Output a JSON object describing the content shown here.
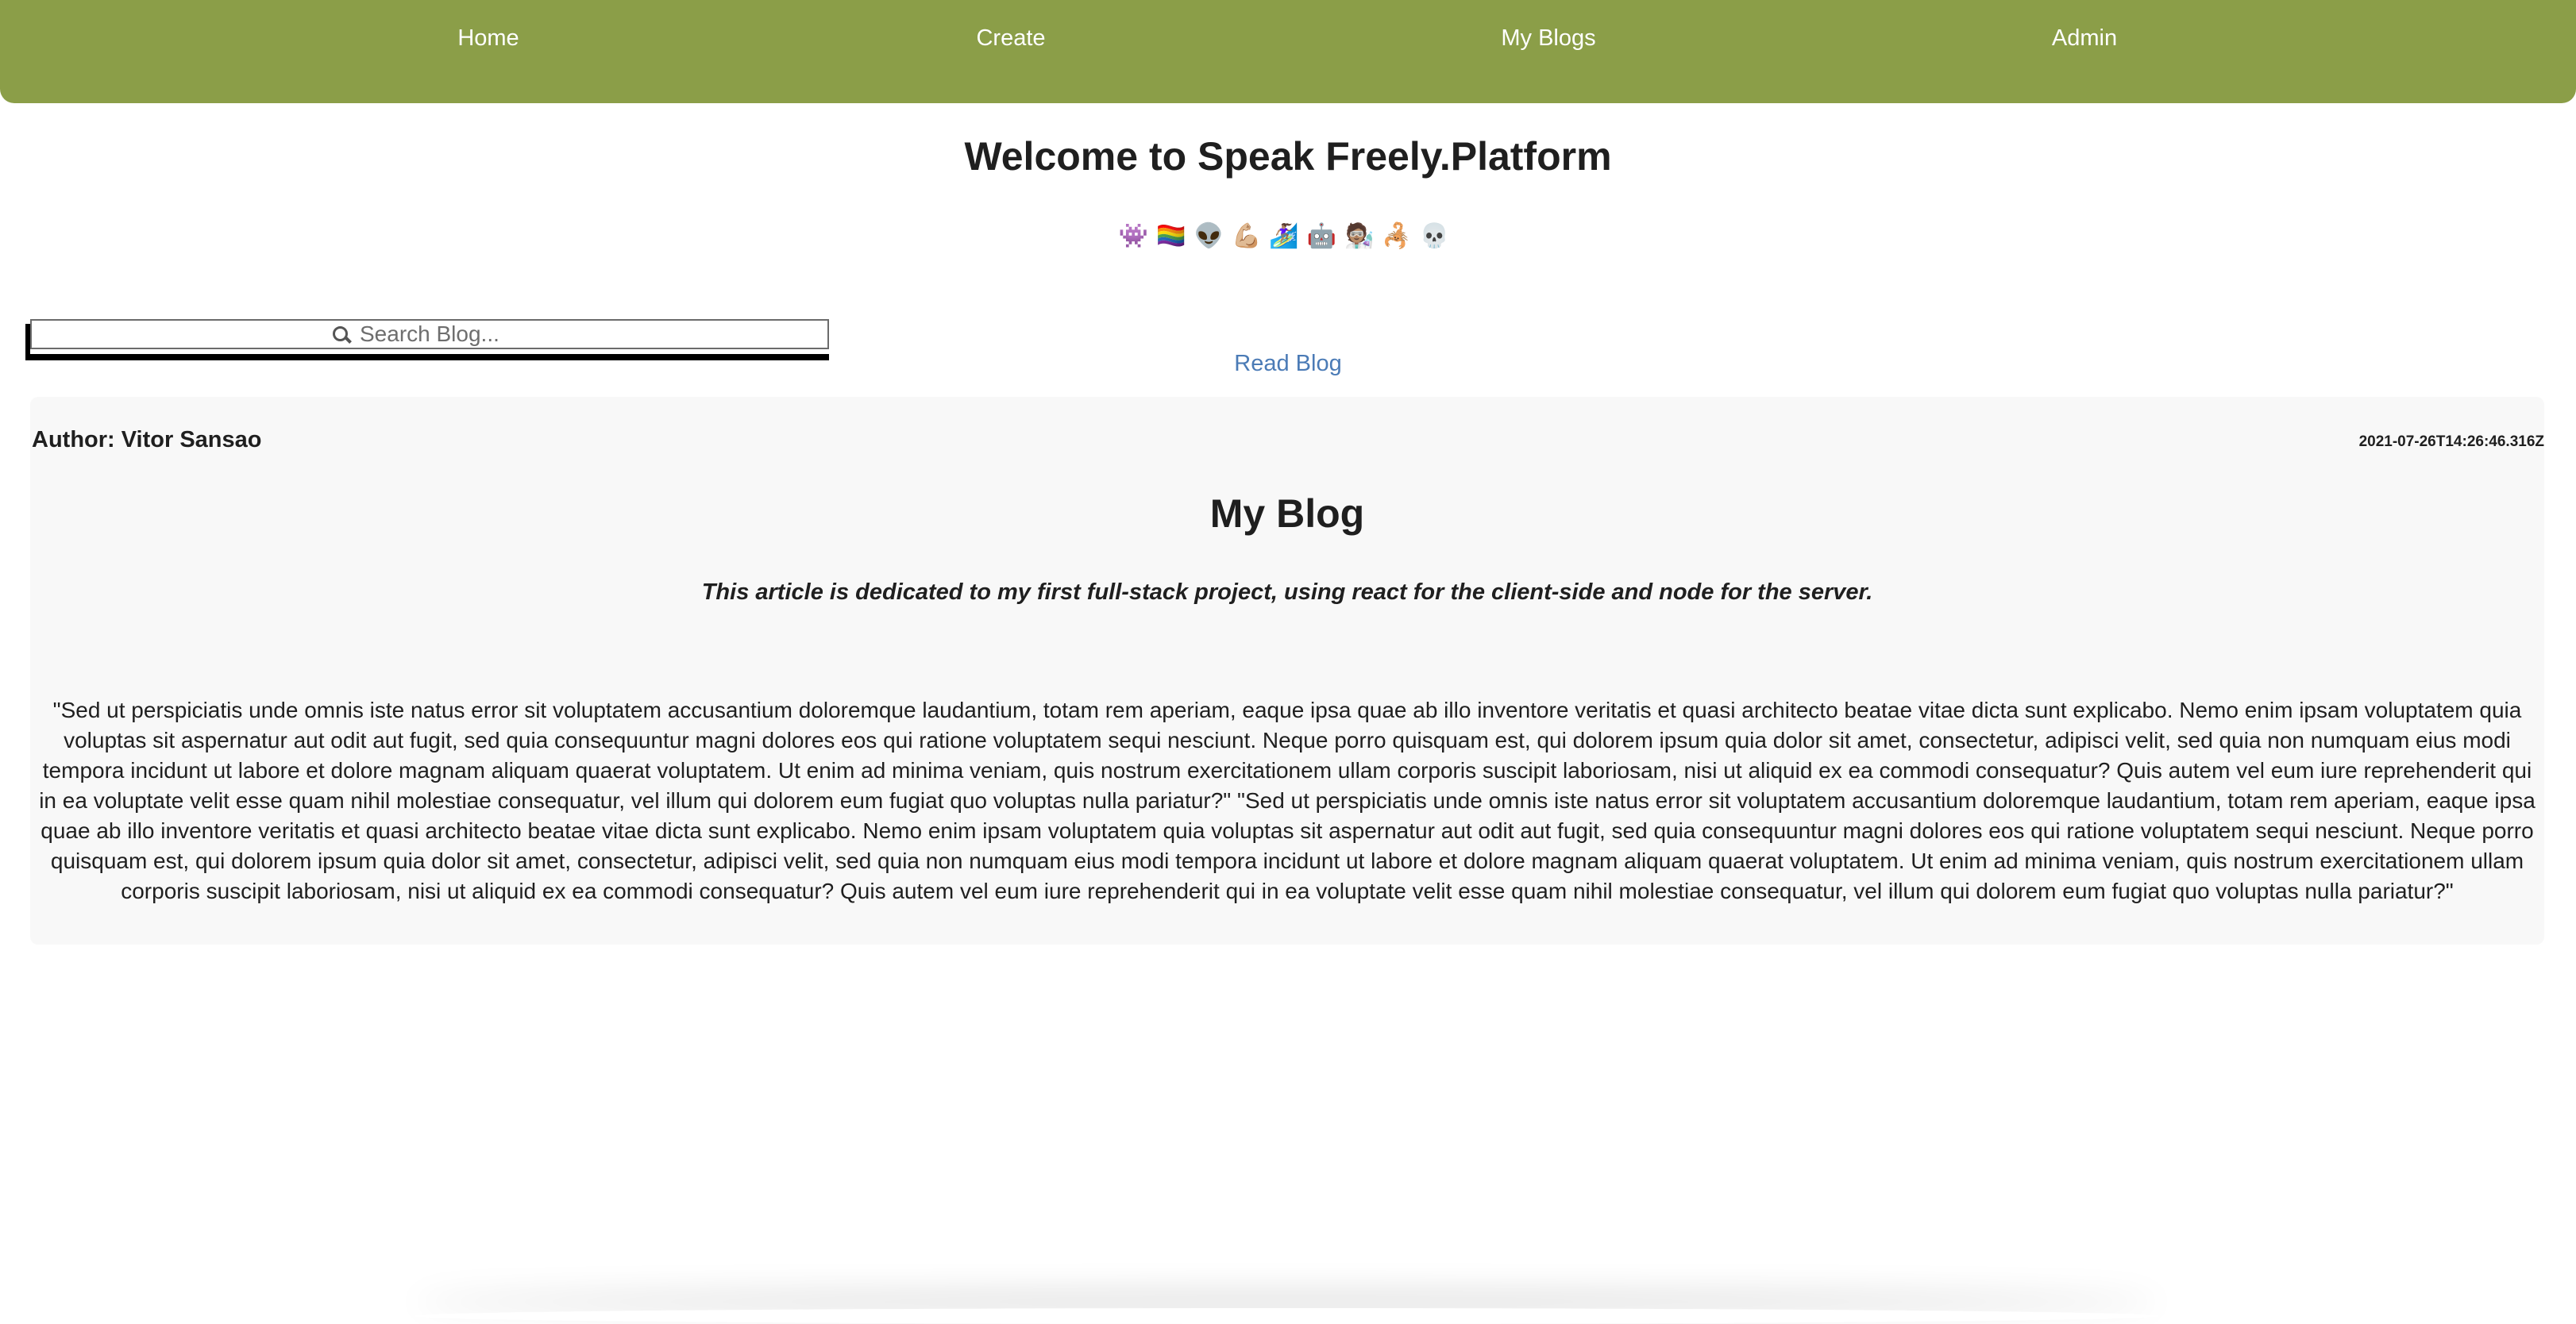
{
  "nav": {
    "items": [
      {
        "label": "Home"
      },
      {
        "label": "Create"
      },
      {
        "label": "My Blogs"
      },
      {
        "label": "Admin"
      }
    ],
    "background_color": "#8b9e48"
  },
  "header": {
    "title": "Welcome to Speak Freely.Platform",
    "emojis": "👾🏳️‍🌈👽💪🏼🏄🏽‍♀️🤖🧑🏽‍🔬🦂💀"
  },
  "search": {
    "placeholder": "Search Blog...",
    "value": ""
  },
  "read_blog_link": "Read Blog",
  "post": {
    "author": "Author: Vitor Sansao",
    "date": "2021-07-26T14:26:46.316Z",
    "title": "My Blog",
    "subtitle": "This article is dedicated to my first full-stack project, using react for the client-side and node for the server.",
    "body": "\"Sed ut perspiciatis unde omnis iste natus error sit voluptatem accusantium doloremque laudantium, totam rem aperiam, eaque ipsa quae ab illo inventore veritatis et quasi architecto beatae vitae dicta sunt explicabo. Nemo enim ipsam voluptatem quia voluptas sit aspernatur aut odit aut fugit, sed quia consequuntur magni dolores eos qui ratione voluptatem sequi nesciunt. Neque porro quisquam est, qui dolorem ipsum quia dolor sit amet, consectetur, adipisci velit, sed quia non numquam eius modi tempora incidunt ut labore et dolore magnam aliquam quaerat voluptatem. Ut enim ad minima veniam, quis nostrum exercitationem ullam corporis suscipit laboriosam, nisi ut aliquid ex ea commodi consequatur? Quis autem vel eum iure reprehenderit qui in ea voluptate velit esse quam nihil molestiae consequatur, vel illum qui dolorem eum fugiat quo voluptas nulla pariatur?\" \"Sed ut perspiciatis unde omnis iste natus error sit voluptatem accusantium doloremque laudantium, totam rem aperiam, eaque ipsa quae ab illo inventore veritatis et quasi architecto beatae vitae dicta sunt explicabo. Nemo enim ipsam voluptatem quia voluptas sit aspernatur aut odit aut fugit, sed quia consequuntur magni dolores eos qui ratione voluptatem sequi nesciunt. Neque porro quisquam est, qui dolorem ipsum quia dolor sit amet, consectetur, adipisci velit, sed quia non numquam eius modi tempora incidunt ut labore et dolore magnam aliquam quaerat voluptatem. Ut enim ad minima veniam, quis nostrum exercitationem ullam corporis suscipit laboriosam, nisi ut aliquid ex ea commodi consequatur? Quis autem vel eum iure reprehenderit qui in ea voluptate velit esse quam nihil molestiae consequatur, vel illum qui dolorem eum fugiat quo voluptas nulla pariatur?\""
  },
  "colors": {
    "accent": "#8b9e48",
    "link": "#4b7bb6",
    "card_background": "#f8f8f8"
  }
}
